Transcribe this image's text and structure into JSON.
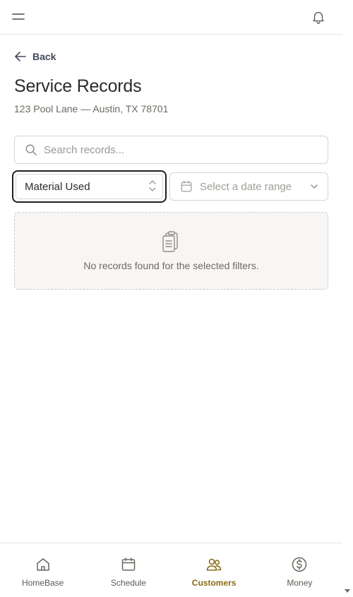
{
  "header": {
    "menu_icon": "hamburger-icon",
    "notification_icon": "bell-icon"
  },
  "nav": {
    "back_label": "Back"
  },
  "page": {
    "title": "Service Records",
    "address": "123 Pool Lane — Austin, TX 78701"
  },
  "filters": {
    "search_placeholder": "Search records...",
    "search_value": "",
    "record_type_selected": "Material Used",
    "date_range_placeholder": "Select a date range"
  },
  "empty_state": {
    "icon": "clipboard-list-icon",
    "message": "No records found for the selected filters."
  },
  "bottom_nav": {
    "items": [
      {
        "label": "HomeBase",
        "icon": "home-icon",
        "active": false
      },
      {
        "label": "Schedule",
        "icon": "calendar-icon",
        "active": false
      },
      {
        "label": "Customers",
        "icon": "users-icon",
        "active": true
      },
      {
        "label": "Money",
        "icon": "dollar-circle-icon",
        "active": false
      }
    ]
  },
  "colors": {
    "accent": "#8a6a16",
    "text_primary": "#2b2b2b",
    "text_muted": "#6e6a64",
    "border": "#d8d5cf",
    "focus_ring": "#1f1f1f",
    "empty_bg": "#f7f6f4"
  }
}
